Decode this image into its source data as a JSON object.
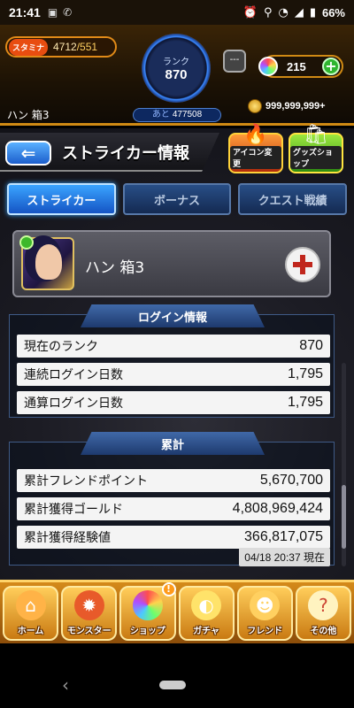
{
  "status_bar": {
    "time": "21:41",
    "battery": "66%"
  },
  "header": {
    "stamina_label": "スタミナ",
    "stamina_current": "4712",
    "stamina_max": "/551",
    "rank_label": "ランク",
    "rank_value": "870",
    "next_exp_label": "あと",
    "next_exp_value": "477508",
    "item_slot": "---",
    "gems": "215",
    "gold": "999,999,999+",
    "player_name": "ハン 箱3"
  },
  "screen": {
    "title": "ストライカー情報",
    "icon_change_label": "アイコン変更",
    "goods_shop_label": "グッズショップ"
  },
  "tabs": [
    {
      "label": "ストライカー",
      "active": true
    },
    {
      "label": "ボーナス",
      "active": false
    },
    {
      "label": "クエスト戦績",
      "active": false
    }
  ],
  "profile": {
    "name": "ハン 箱3"
  },
  "login_info": {
    "heading": "ログイン情報",
    "rows": [
      {
        "label": "現在のランク",
        "value": "870"
      },
      {
        "label": "連続ログイン日数",
        "value": "1,795"
      },
      {
        "label": "通算ログイン日数",
        "value": "1,795"
      }
    ]
  },
  "totals": {
    "heading": "累計",
    "rows": [
      {
        "label": "累計フレンドポイント",
        "value": "5,670,700"
      },
      {
        "label": "累計獲得ゴールド",
        "value": "4,808,969,424"
      },
      {
        "label": "累計獲得経験値",
        "value": "366,817,075"
      }
    ],
    "timestamp": "04/18 20:37 現在"
  },
  "bottom_nav": [
    {
      "label": "ホーム",
      "icon": "home-icon"
    },
    {
      "label": "モンスター",
      "icon": "monster-icon"
    },
    {
      "label": "ショップ",
      "icon": "shop-icon",
      "notice": "!"
    },
    {
      "label": "ガチャ",
      "icon": "gacha-icon"
    },
    {
      "label": "フレンド",
      "icon": "friend-icon"
    },
    {
      "label": "その他",
      "icon": "other-icon"
    }
  ],
  "colors": {
    "accent_orange": "#d08a14",
    "tab_active": "#3aa4ff",
    "panel_head": "#4069a8",
    "add_friend_cross": "#c0261c"
  }
}
